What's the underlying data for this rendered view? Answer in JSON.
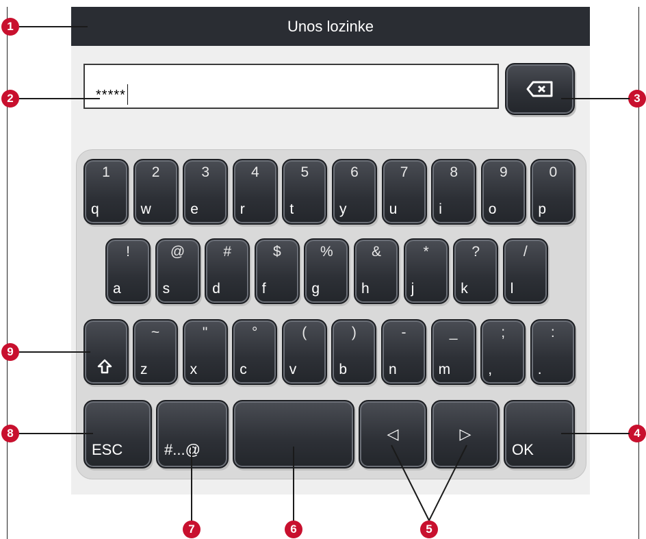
{
  "screen": {
    "title": "Unos lozinke",
    "password_value": "*****"
  },
  "keyboard": {
    "row1": [
      {
        "top": "1",
        "bottom": "q"
      },
      {
        "top": "2",
        "bottom": "w"
      },
      {
        "top": "3",
        "bottom": "e"
      },
      {
        "top": "4",
        "bottom": "r"
      },
      {
        "top": "5",
        "bottom": "t"
      },
      {
        "top": "6",
        "bottom": "y"
      },
      {
        "top": "7",
        "bottom": "u"
      },
      {
        "top": "8",
        "bottom": "i"
      },
      {
        "top": "9",
        "bottom": "o"
      },
      {
        "top": "0",
        "bottom": "p"
      }
    ],
    "row2": [
      {
        "top": "!",
        "bottom": "a"
      },
      {
        "top": "@",
        "bottom": "s"
      },
      {
        "top": "#",
        "bottom": "d"
      },
      {
        "top": "$",
        "bottom": "f"
      },
      {
        "top": "%",
        "bottom": "g"
      },
      {
        "top": "&",
        "bottom": "h"
      },
      {
        "top": "*",
        "bottom": "j"
      },
      {
        "top": "?",
        "bottom": "k"
      },
      {
        "top": "/",
        "bottom": "l"
      }
    ],
    "row3": [
      {
        "top": "~",
        "bottom": "z"
      },
      {
        "top": "\"",
        "bottom": "x"
      },
      {
        "top": "°",
        "bottom": "c"
      },
      {
        "top": "(",
        "bottom": "v"
      },
      {
        "top": ")",
        "bottom": "b"
      },
      {
        "top": "-",
        "bottom": "n"
      },
      {
        "top": "_",
        "bottom": "m"
      },
      {
        "top": ";",
        "bottom": ","
      },
      {
        "top": ":",
        "bottom": "."
      }
    ],
    "shift_icon": "shift-arrow-icon",
    "backspace_icon": "backspace-icon",
    "esc_label": "ESC",
    "symbols_label": "#...@",
    "space_label": "",
    "left_arrow": "◁",
    "right_arrow": "▷",
    "ok_label": "OK"
  },
  "callouts": [
    "1",
    "2",
    "3",
    "4",
    "5",
    "6",
    "7",
    "8",
    "9"
  ],
  "colors": {
    "callout_red": "#c8102e",
    "titlebar": "#2a2d33",
    "key_dark": "#2d3036"
  }
}
